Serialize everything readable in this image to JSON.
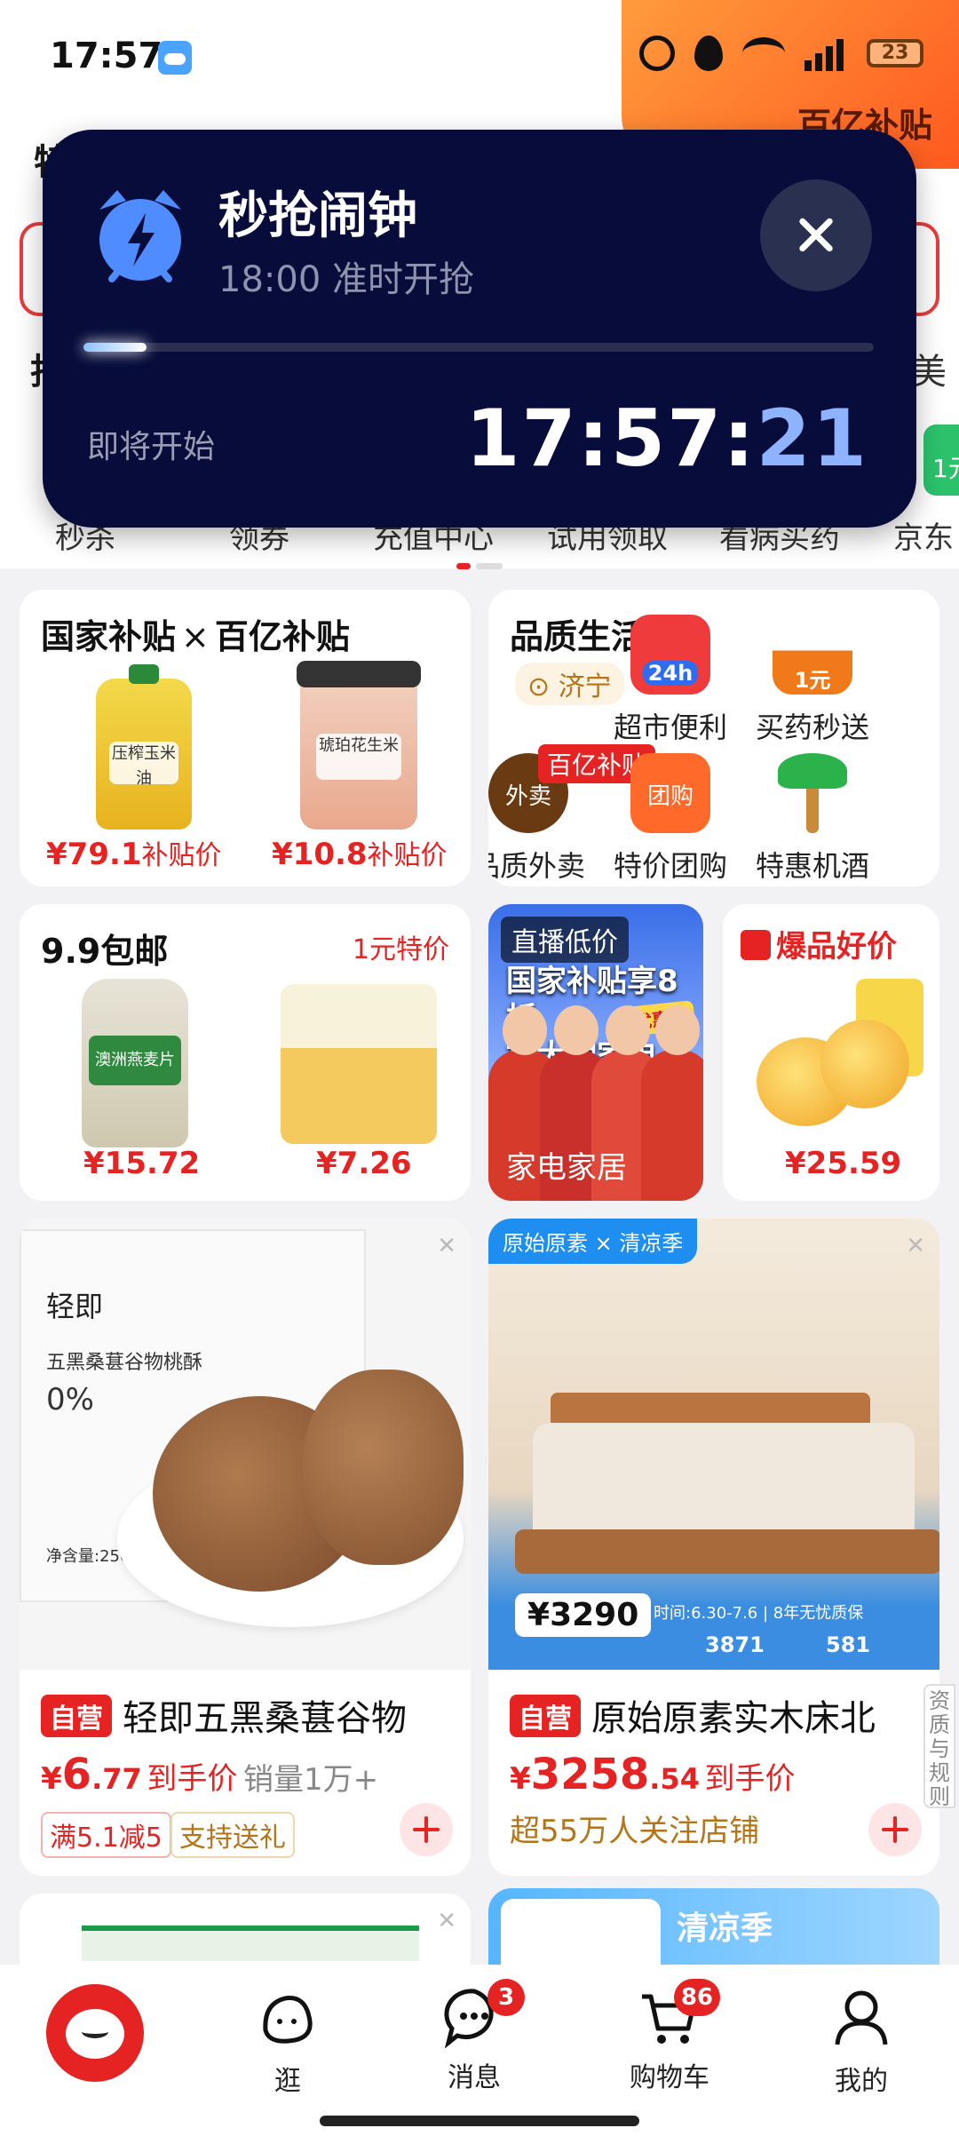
{
  "status_bar": {
    "time": "17:57",
    "battery": "23",
    "network": "5G"
  },
  "header": {
    "promo_label": "百亿补贴",
    "behind_left_char": "特",
    "behind_left2_char": "抖",
    "behind_right_char": "美"
  },
  "alarm": {
    "title": "秒抢闹钟",
    "subtitle": "18:00 准时开抢",
    "status": "即将开始",
    "clock_hm": "17:57:",
    "clock_sec": "21",
    "progress": 0.08
  },
  "quick_icons": {
    "labels": [
      "秒杀",
      "领券",
      "充值中心",
      "试用领取",
      "看病买药",
      "京东"
    ]
  },
  "promo_chip": "1元",
  "subsidy_card": {
    "title_left": "国家补贴",
    "title_x": "×",
    "title_right": "百亿补贴",
    "products": [
      {
        "img_label": "压榨玉米油",
        "price": "¥79.1",
        "suffix": "补贴价"
      },
      {
        "img_label": "琥珀花生米",
        "price": "¥10.8",
        "suffix": "补贴价"
      }
    ]
  },
  "quality_card": {
    "title": "品质生活",
    "location": "济宁",
    "services": [
      {
        "label": "超市便利",
        "icon_text": "24h",
        "color": "#ef3b3b"
      },
      {
        "label": "买药秒送",
        "icon_text": "1元",
        "color": "#f07a1a"
      },
      {
        "label": "品质外卖",
        "icon_text": "外卖",
        "color": "#6a3a12",
        "badge": "百亿补贴"
      },
      {
        "label": "特价团购",
        "icon_text": "团购",
        "color": "#ff6a2b"
      },
      {
        "label": "特惠机酒",
        "icon_text": "",
        "color": "#2bb24a"
      }
    ]
  },
  "ninenine_card": {
    "title": "9.9包邮",
    "tag": "1元特价",
    "products": [
      {
        "img_label": "澳洲燕麦片",
        "price": "¥15.72"
      },
      {
        "img_label": "",
        "price": "¥7.26"
      }
    ]
  },
  "live_card": {
    "tag": "直播低价",
    "headline_1": "国家补贴享8折",
    "headline_2": "抢大牌家电",
    "coupon": "优惠券",
    "bottom": "家电家居"
  },
  "hot_card": {
    "tag": "爆品好价",
    "price": "¥25.59"
  },
  "feed": [
    {
      "self_tag": "自营",
      "title": "轻即五黑桑葚谷物",
      "price_cur": "¥",
      "price_int": "6",
      "price_dec": ".77",
      "price_suffix": "到手价",
      "sales": "销量1万+",
      "chip1": "满5.1减5",
      "chip2": "支持送礼",
      "img_brand": "轻即",
      "img_line": "五黑桑葚谷物桃酥",
      "img_pct": "0%",
      "img_weight": "净含量:250g"
    },
    {
      "self_tag": "自营",
      "title": "原始原素实木床北",
      "price_cur": "¥",
      "price_int": "3258",
      "price_dec": ".54",
      "price_suffix": "到手价",
      "follow": "超55万人关注店铺",
      "img_brand": "原始原素",
      "img_season": "清凉季",
      "img_badge_price": "3290",
      "img_time": "时间:6.30-7.6",
      "img_guarantee": "8年无忧质保",
      "img_price_a": "3871",
      "img_price_b": "581"
    }
  ],
  "feed_peek": {
    "right_title": "清凉季"
  },
  "side_tab": "资质与规则",
  "bottom_nav": {
    "items": [
      {
        "label": "逛"
      },
      {
        "label": "消息",
        "badge": "3"
      },
      {
        "label": "购物车",
        "badge": "86"
      },
      {
        "label": "我的"
      }
    ]
  },
  "colors": {
    "accent": "#e52323",
    "alarm_bg": "#070c3a",
    "promo_orange": "#ff7a2a"
  }
}
